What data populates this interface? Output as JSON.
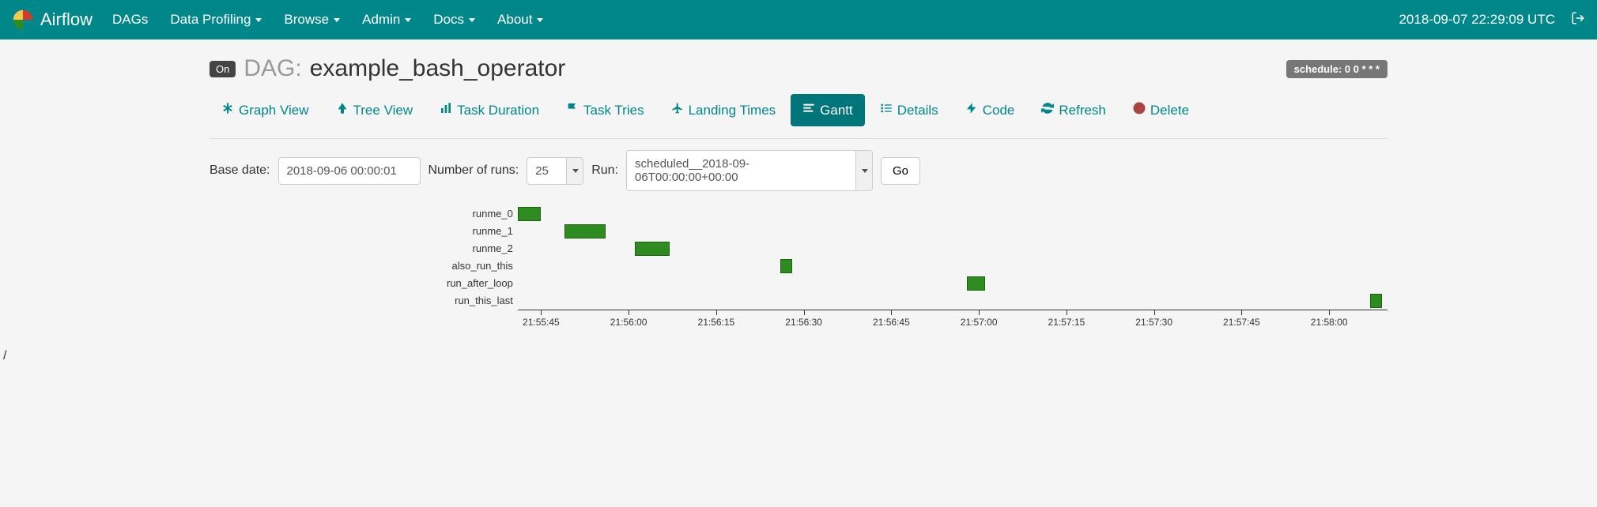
{
  "navbar": {
    "brand": "Airflow",
    "items": [
      "DAGs",
      "Data Profiling",
      "Browse",
      "Admin",
      "Docs",
      "About"
    ],
    "items_has_caret": [
      false,
      true,
      true,
      true,
      true,
      true
    ],
    "clock": "2018-09-07 22:29:09 UTC"
  },
  "dag": {
    "toggle": "On",
    "label": "DAG:",
    "name": "example_bash_operator",
    "schedule_label": "schedule: 0 0 * * *"
  },
  "tabs": {
    "graph": "Graph View",
    "tree": "Tree View",
    "duration": "Task Duration",
    "tries": "Task Tries",
    "landing": "Landing Times",
    "gantt": "Gantt",
    "details": "Details",
    "code": "Code",
    "refresh": "Refresh",
    "delete": "Delete"
  },
  "controls": {
    "base_date_label": "Base date:",
    "base_date_value": "2018-09-06 00:00:01",
    "num_runs_label": "Number of runs:",
    "num_runs_value": "25",
    "run_label": "Run:",
    "run_value": "scheduled__2018-09-06T00:00:00+00:00",
    "go": "Go"
  },
  "chart_data": {
    "type": "gantt",
    "tasks": [
      "runme_0",
      "runme_1",
      "runme_2",
      "also_run_this",
      "run_after_loop",
      "run_this_last"
    ],
    "x_axis_ticks": [
      "21:55:45",
      "21:56:00",
      "21:56:15",
      "21:56:30",
      "21:56:45",
      "21:57:00",
      "21:57:15",
      "21:57:30",
      "21:57:45",
      "21:58:00"
    ],
    "x_axis_start": "21:55:41",
    "x_axis_end": "21:58:10",
    "series": [
      {
        "task": "runme_0",
        "start": "21:55:41",
        "end": "21:55:45"
      },
      {
        "task": "runme_1",
        "start": "21:55:49",
        "end": "21:55:56"
      },
      {
        "task": "runme_2",
        "start": "21:56:01",
        "end": "21:56:07"
      },
      {
        "task": "also_run_this",
        "start": "21:56:26",
        "end": "21:56:28"
      },
      {
        "task": "run_after_loop",
        "start": "21:56:58",
        "end": "21:57:01"
      },
      {
        "task": "run_this_last",
        "start": "21:58:07",
        "end": "21:58:09"
      }
    ],
    "bar_color": "#2e8b1f"
  }
}
